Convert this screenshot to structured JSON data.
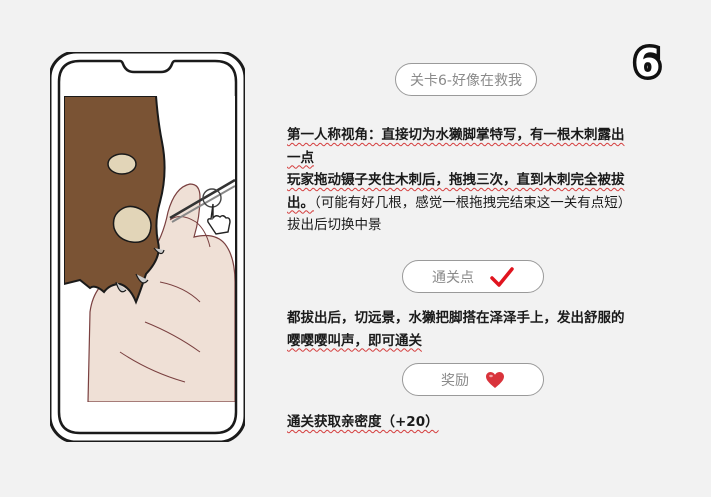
{
  "level_number": "6",
  "level_title": "关卡6-好像在救我",
  "description": {
    "line1": "第一人称视角：直接切为水獭脚掌特写，有一根木刺露出",
    "line1b": "一点",
    "line2": "玩家拖动镊子夹住木刺后，拖拽三次，直到木刺完全被拔",
    "line2b": "出。",
    "line2c": "（可能有好几根，感觉一根拖拽完结束这一关有点短）",
    "line3": "拔出后切换中景"
  },
  "clear_button": {
    "label": "通关点",
    "icon": "checkmark-icon",
    "icon_color": "#e0141e"
  },
  "clear_description": {
    "line1": "都拔出后，切远景，水獭把脚搭在泽泽手上，发出舒服的",
    "line2": "嘤嘤嘤叫声，即可通关"
  },
  "reward_button": {
    "label": "奖励",
    "icon": "heart-icon",
    "icon_color": "#d9333b"
  },
  "reward_text": "通关获取亲密度（+20）",
  "colors": {
    "otter_fur": "#7a5334",
    "skin": "#efe0d6",
    "pad": "#e2d5b8",
    "outline": "#1a1a1a"
  }
}
